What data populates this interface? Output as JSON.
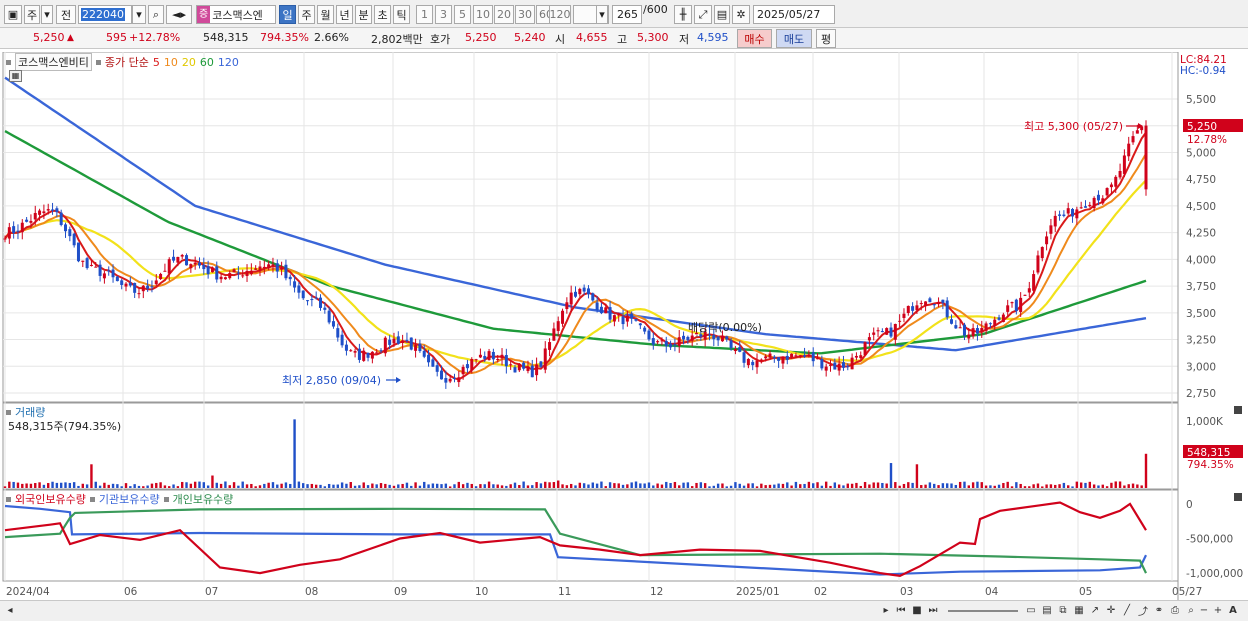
{
  "toolbar": {
    "market": "주",
    "prev_label": "전",
    "code": "222040",
    "name_tag": "증",
    "name": "코스맥스엔",
    "periods": [
      "일",
      "주",
      "월",
      "년",
      "분",
      "초",
      "틱"
    ],
    "active_period": "일",
    "intervals": [
      "1",
      "3",
      "5",
      "10",
      "20",
      "30",
      "60",
      "120"
    ],
    "count": "265",
    "count_max": "/600",
    "date": "2025/05/27"
  },
  "quote": {
    "price": "5,250",
    "change": "595",
    "change_pct": "+12.78%",
    "volume": "548,315",
    "volume_ratio": "794.35%",
    "turnover": "2.66%",
    "amount": "2,802백만",
    "bid_label": "호가",
    "ask": "5,250",
    "bid": "5,240",
    "open_label": "시",
    "open": "4,655",
    "high_label": "고",
    "high": "5,300",
    "low_label": "저",
    "low": "4,595",
    "buy_label": "매수",
    "sell_label": "매도",
    "eval_label": "평"
  },
  "price_panel": {
    "title": "코스맥스엔비티",
    "ma_label": "종가 단순",
    "ma_periods": [
      "5",
      "10",
      "20",
      "60",
      "120"
    ],
    "lc_label": "LC:84.21",
    "hc_label": "HC:-0.94",
    "high_annotation": "최고 5,300 (05/27)",
    "low_annotation": "최저 2,850 (09/04)",
    "dividend_annotation": "배당락(0.00%)",
    "last_price_tag": "5,250",
    "last_change_tag": "12.78%",
    "y_ticks": [
      "5,500",
      "5,250",
      "5,000",
      "4,750",
      "4,500",
      "4,250",
      "4,000",
      "3,750",
      "3,500",
      "3,250",
      "3,000",
      "2,750"
    ]
  },
  "volume_panel": {
    "title": "거래량",
    "subtitle": "548,315주(794.35%)",
    "y_ticks": [
      "1,000K"
    ],
    "last_volume_tag": "548,315",
    "last_ratio_tag": "794.35%"
  },
  "holding_panel": {
    "titles": [
      "외국인보유수량",
      "기관보유수량",
      "개인보유수량"
    ],
    "y_ticks": [
      "0",
      "-500,000",
      "-1,000,000"
    ]
  },
  "x_axis": [
    "2024/04",
    "06",
    "07",
    "08",
    "09",
    "10",
    "11",
    "12",
    "2025/01",
    "02",
    "03",
    "04",
    "05",
    "05/27"
  ],
  "colors": {
    "up": "#d0021b",
    "down": "#1f4fc8",
    "ma5": "#d91a1a",
    "ma10": "#ef8a1c",
    "ma20": "#f2e21a",
    "ma60": "#1e9a3a",
    "ma120": "#3a66d8",
    "foreign": "#d0021b",
    "institution": "#3a66d8",
    "individual": "#3a9a5a"
  },
  "chart_data": {
    "type": "candlestick",
    "price_range": [
      2750,
      5500
    ],
    "anchors": [
      {
        "date": "2024/04",
        "close": 4250
      },
      {
        "date": "2024/05",
        "close": 4450
      },
      {
        "date": "2024/05",
        "close": 3900
      },
      {
        "date": "2024/06",
        "close": 3700
      },
      {
        "date": "2024/06",
        "close": 4000
      },
      {
        "date": "2024/07",
        "close": 3850
      },
      {
        "date": "2024/07",
        "close": 3950
      },
      {
        "date": "2024/08",
        "close": 3600
      },
      {
        "date": "2024/08",
        "close": 3100
      },
      {
        "date": "2024/09",
        "close": 3250
      },
      {
        "date": "2024/09",
        "close": 2900
      },
      {
        "date": "2024/10",
        "close": 3100
      },
      {
        "date": "2024/10",
        "close": 2950
      },
      {
        "date": "2024/11",
        "close": 3700
      },
      {
        "date": "2024/11",
        "close": 3450
      },
      {
        "date": "2024/11",
        "close": 3200
      },
      {
        "date": "2024/12",
        "close": 3300
      },
      {
        "date": "2024/12",
        "close": 3050
      },
      {
        "date": "2025/01",
        "close": 3100
      },
      {
        "date": "2025/02",
        "close": 3000
      },
      {
        "date": "2025/03",
        "close": 3300
      },
      {
        "date": "2025/03",
        "close": 3650
      },
      {
        "date": "2025/04",
        "close": 3300
      },
      {
        "date": "2025/04",
        "close": 3550
      },
      {
        "date": "2025/05",
        "close": 4400
      },
      {
        "date": "2025/05",
        "close": 4600
      },
      {
        "date": "05/27",
        "close": 5250
      }
    ],
    "ma60": [
      {
        "date": "2024/04",
        "value": 5200
      },
      {
        "date": "2024/06",
        "value": 4350
      },
      {
        "date": "2024/08",
        "value": 3750
      },
      {
        "date": "2024/10",
        "value": 3350
      },
      {
        "date": "2024/12",
        "value": 3200
      },
      {
        "date": "2025/02",
        "value": 3120
      },
      {
        "date": "2025/04",
        "value": 3300
      },
      {
        "date": "05/27",
        "value": 3800
      }
    ],
    "ma120": [
      {
        "date": "2024/04",
        "value": 5700
      },
      {
        "date": "2024/07",
        "value": 4500
      },
      {
        "date": "2024/09",
        "value": 3950
      },
      {
        "date": "2024/11",
        "value": 3550
      },
      {
        "date": "2025/01",
        "value": 3300
      },
      {
        "date": "2025/03",
        "value": 3150
      },
      {
        "date": "05/27",
        "value": 3450
      }
    ],
    "volume_peaks": [
      {
        "date": "2024/04",
        "value": 400000
      },
      {
        "date": "2024/06",
        "value": 1100000
      },
      {
        "date": "2024/10",
        "value": 400000
      },
      {
        "date": "2024/11",
        "value": 420000
      },
      {
        "date": "05/27",
        "value": 548315
      }
    ],
    "holdings_end": {
      "foreign": -400000,
      "institution": -800000,
      "individual": -1000000
    }
  }
}
